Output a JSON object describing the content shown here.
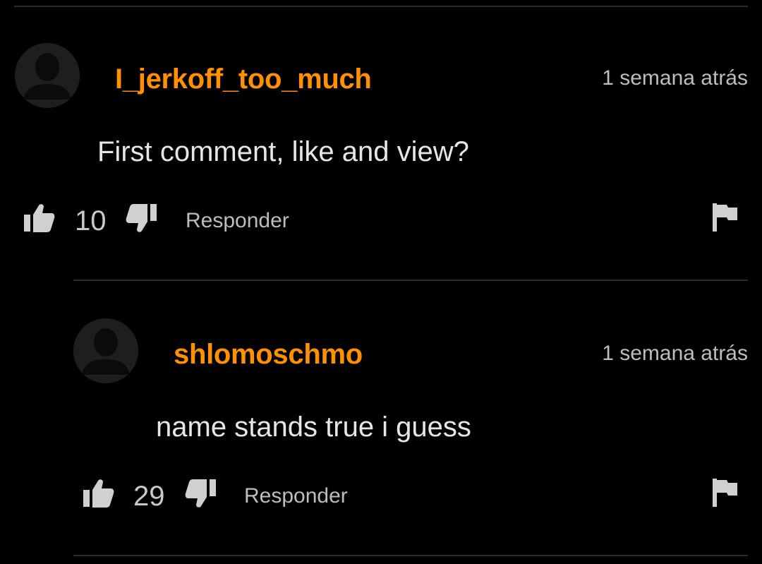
{
  "comments": [
    {
      "username": "I_jerkoff_too_much",
      "timestamp": "1 semana atrás",
      "text": "First comment, like and view?",
      "likes": "10",
      "reply_label": "Responder"
    },
    {
      "username": "shlomoschmo",
      "timestamp": "1 semana atrás",
      "text": "name stands true i guess",
      "likes": "29",
      "reply_label": "Responder"
    }
  ],
  "colors": {
    "background": "#000000",
    "username": "#ff9000",
    "text": "#e6e6e6",
    "muted": "#bdbdbd",
    "icon": "#d0d0d0"
  },
  "icons": {
    "avatar": "user-silhouette-icon",
    "like": "thumbs-up-icon",
    "dislike": "thumbs-down-icon",
    "flag": "flag-icon"
  }
}
